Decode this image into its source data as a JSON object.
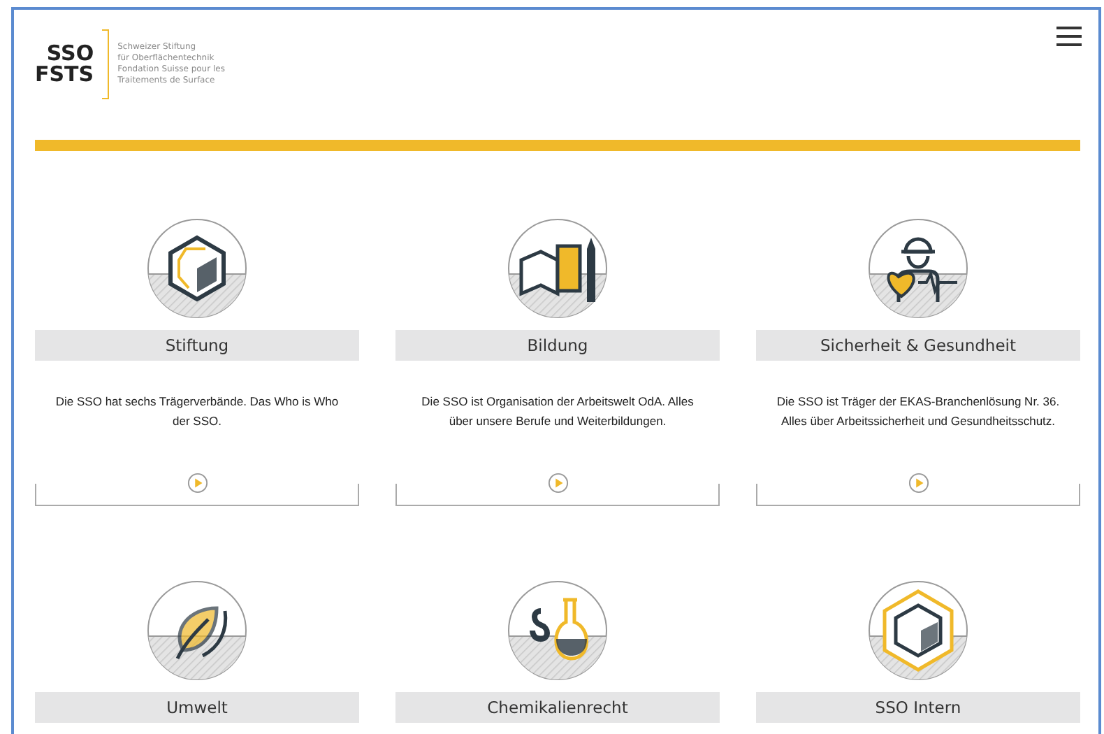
{
  "header": {
    "logo": {
      "line_1": "SSO",
      "line_2": "FSTS"
    },
    "tagline": [
      "Schweizer Stiftung",
      "für Oberflächentechnik",
      "Fondation Suisse pour les",
      "Traitements de Surface"
    ]
  },
  "cards": [
    {
      "title": "Stiftung",
      "text": "Die SSO hat sechs Trägerverbände. Das Who is Who der SSO."
    },
    {
      "title": "Bildung",
      "text": "Die SSO ist Organisation der Arbeitswelt OdA. Alles über unsere Berufe und Weiterbildungen."
    },
    {
      "title": "Sicherheit & Gesundheit",
      "text": "Die SSO ist Träger der EKAS-Branchenlösung Nr. 36. Alles über Arbeitssicherheit und Gesundheitsschutz."
    },
    {
      "title": "Umwelt"
    },
    {
      "title": "Chemikalienrecht"
    },
    {
      "title": "SSO Intern"
    }
  ]
}
